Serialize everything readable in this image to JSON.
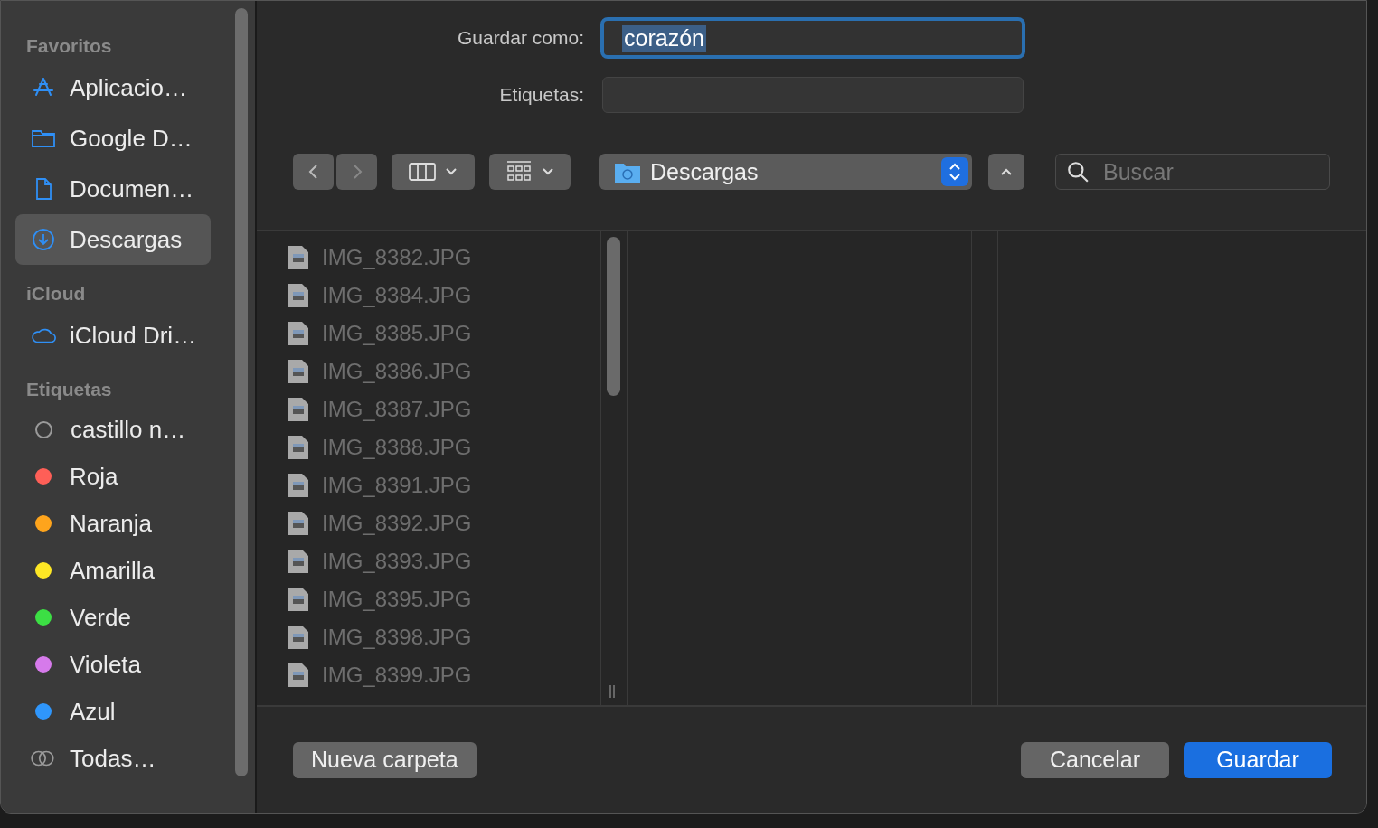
{
  "sidebar": {
    "sections": [
      {
        "title": "Favoritos",
        "items": [
          {
            "label": "Aplicacio…",
            "kind": "apps",
            "selected": false
          },
          {
            "label": "Google D…",
            "kind": "folder",
            "selected": false
          },
          {
            "label": "Documen…",
            "kind": "document",
            "selected": false
          },
          {
            "label": "Descargas",
            "kind": "download",
            "selected": true
          }
        ]
      },
      {
        "title": "iCloud",
        "items": [
          {
            "label": "iCloud Dri…",
            "kind": "cloud",
            "selected": false
          }
        ]
      },
      {
        "title": "Etiquetas",
        "items": [
          {
            "label": "castillo n…",
            "kind": "ring",
            "selected": false
          },
          {
            "label": "Roja",
            "kind": "tag",
            "color": "#fe5f57",
            "selected": false
          },
          {
            "label": "Naranja",
            "kind": "tag",
            "color": "#fea41c",
            "selected": false
          },
          {
            "label": "Amarilla",
            "kind": "tag",
            "color": "#fde725",
            "selected": false
          },
          {
            "label": "Verde",
            "kind": "tag",
            "color": "#3cdf44",
            "selected": false
          },
          {
            "label": "Violeta",
            "kind": "tag",
            "color": "#d67aeb",
            "selected": false
          },
          {
            "label": "Azul",
            "kind": "tag",
            "color": "#2f96fb",
            "selected": false
          },
          {
            "label": "Todas…",
            "kind": "all",
            "selected": false
          }
        ]
      }
    ]
  },
  "save_as": {
    "label": "Guardar como:",
    "value": "corazón"
  },
  "tags": {
    "label": "Etiquetas:"
  },
  "toolbar": {
    "location": "Descargas",
    "search": {
      "placeholder": "Buscar"
    }
  },
  "files": [
    {
      "name": "IMG_8382.JPG"
    },
    {
      "name": "IMG_8384.JPG"
    },
    {
      "name": "IMG_8385.JPG"
    },
    {
      "name": "IMG_8386.JPG"
    },
    {
      "name": "IMG_8387.JPG"
    },
    {
      "name": "IMG_8388.JPG"
    },
    {
      "name": "IMG_8391.JPG"
    },
    {
      "name": "IMG_8392.JPG"
    },
    {
      "name": "IMG_8393.JPG"
    },
    {
      "name": "IMG_8395.JPG"
    },
    {
      "name": "IMG_8398.JPG"
    },
    {
      "name": "IMG_8399.JPG"
    }
  ],
  "buttons": {
    "new_folder": "Nueva carpeta",
    "cancel": "Cancelar",
    "save": "Guardar"
  }
}
